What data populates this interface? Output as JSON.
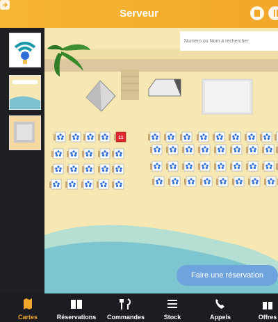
{
  "header": {
    "title": "Serveur"
  },
  "search": {
    "placeholder": "Numéro ou Nom à rechercher"
  },
  "map": {
    "reserve_label": "Faire une réservation",
    "highlighted_umbrella": "11"
  },
  "nav": {
    "items": [
      {
        "label": "Cartes",
        "icon": "map-icon",
        "active": true
      },
      {
        "label": "Réservations",
        "icon": "book-icon",
        "active": false
      },
      {
        "label": "Commandes",
        "icon": "fork-knife-icon",
        "active": false
      },
      {
        "label": "Stock",
        "icon": "list-icon",
        "active": false
      },
      {
        "label": "Appels",
        "icon": "phone-icon",
        "active": false
      },
      {
        "label": "Offres",
        "icon": "gift-icon",
        "active": false
      }
    ]
  },
  "colors": {
    "header": "#f2a72a",
    "accent": "#f2a72a",
    "reserve_button": "#6fa3dd",
    "sand": "#f6e7b3"
  }
}
